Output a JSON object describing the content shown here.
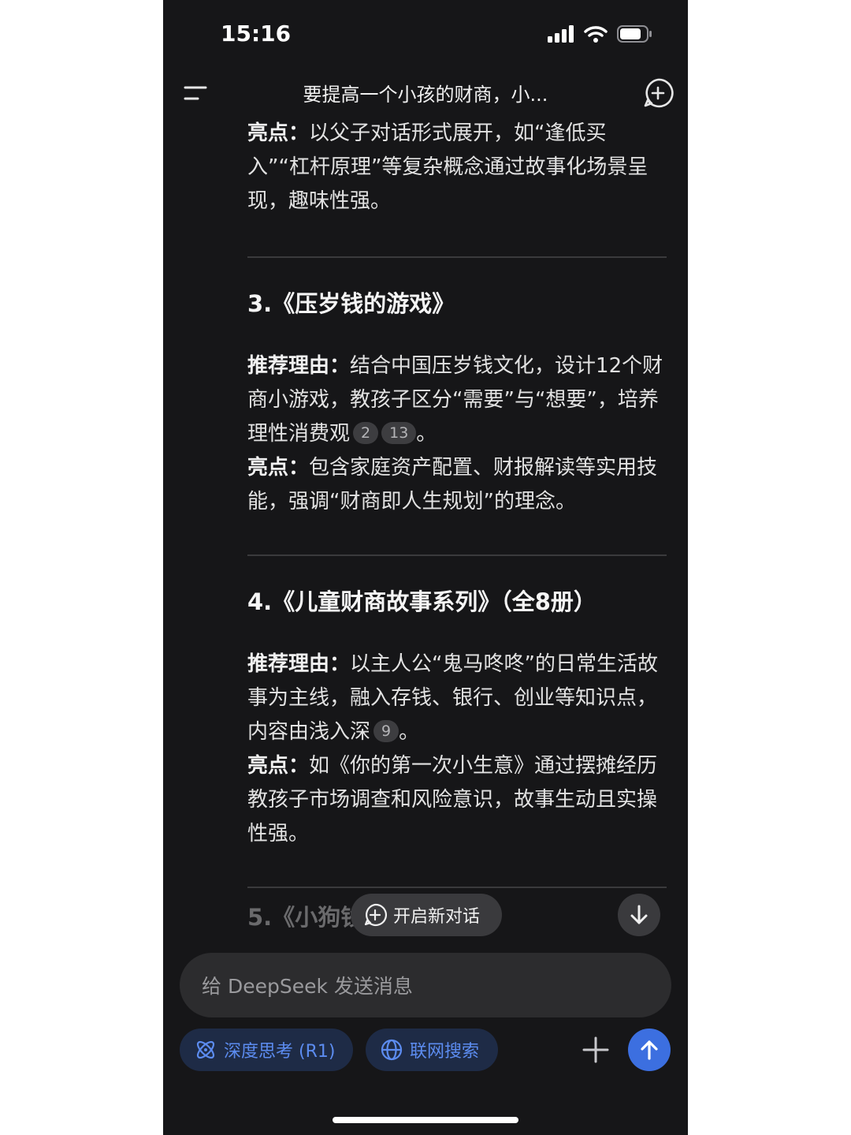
{
  "status": {
    "time": "15:16"
  },
  "header": {
    "title": "要提高一个小孩的财商，小..."
  },
  "content": {
    "intro": {
      "label": "亮点",
      "colon": "：",
      "text": "以父子对话形式展开，如“逢低买入”“杠杆原理”等复杂概念通过故事化场景呈现，趣味性强。"
    },
    "items": [
      {
        "title": "3.《压岁钱的游戏》",
        "reason_label": "推荐理由",
        "reason_text": "结合中国压岁钱文化，设计12个财商小游戏，教孩子区分“需要”与“想要”，培养理性消费观",
        "citations": [
          "2",
          "13"
        ],
        "period": "。",
        "highlight_label": "亮点",
        "highlight_text": "包含家庭资产配置、财报解读等实用技能，强调“财商即人生规划”的理念。"
      },
      {
        "title": "4.《儿童财商故事系列》（全8册）",
        "reason_label": "推荐理由",
        "reason_text": "以主人公“鬼马咚咚”的日常生活故事为主线，融入存钱、银行、创业等知识点，内容由浅入深",
        "citations": [
          "9"
        ],
        "period": "。",
        "highlight_label": "亮点",
        "highlight_text": "如《你的第一次小生意》通过摆摊经历教孩子市场调查和风险意识，故事生动且实操性强。"
      }
    ],
    "next_title_partial": "5.《小狗钱"
  },
  "floating": {
    "new_chat_label": "开启新对话"
  },
  "composer": {
    "placeholder": "给 DeepSeek 发送消息"
  },
  "toolbar": {
    "deep_think_label": "深度思考 (R1)",
    "web_search_label": "联网搜索"
  },
  "colors": {
    "accent": "#3c6fe0",
    "chip_text": "#5c8cf0",
    "background": "#161618"
  }
}
